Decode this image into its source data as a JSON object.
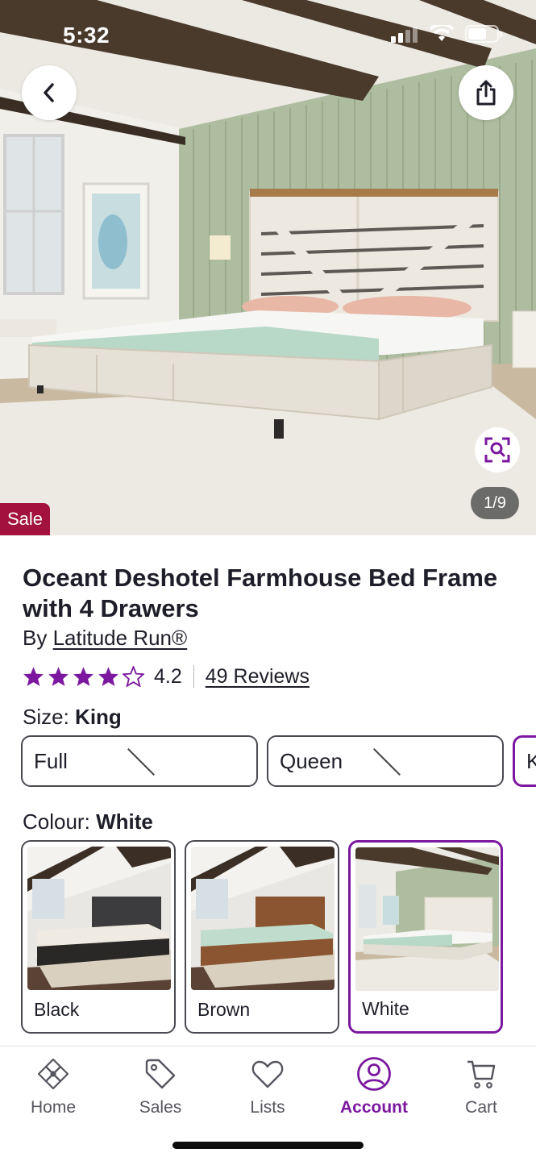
{
  "status_bar": {
    "time": "5:32"
  },
  "hero": {
    "image_counter": "1/9",
    "sale_badge": "Sale",
    "icons": {
      "back": "chevron-left-icon",
      "share": "share-icon",
      "visual_search": "visual-search-icon"
    }
  },
  "product": {
    "title": "Oceant Deshotel Farmhouse Bed Frame with 4 Drawers",
    "by_prefix": "By",
    "brand": "Latitude Run®",
    "rating_value": "4.2",
    "rating_stars": 4.2,
    "reviews": "49 Reviews"
  },
  "size": {
    "label": "Size:",
    "selected": "King",
    "options": [
      {
        "label": "Full",
        "unavailable": true
      },
      {
        "label": "Queen",
        "unavailable": true
      },
      {
        "label": "K",
        "unavailable": false
      }
    ]
  },
  "colour": {
    "label": "Colour:",
    "selected": "White",
    "options": [
      {
        "label": "Black"
      },
      {
        "label": "Brown"
      },
      {
        "label": "White"
      }
    ]
  },
  "bottom_nav": {
    "items": [
      {
        "label": "Home",
        "icon": "home-icon"
      },
      {
        "label": "Sales",
        "icon": "tag-icon"
      },
      {
        "label": "Lists",
        "icon": "heart-icon"
      },
      {
        "label": "Account",
        "icon": "account-icon",
        "active": true
      },
      {
        "label": "Cart",
        "icon": "cart-icon"
      }
    ]
  },
  "colors": {
    "accent": "#7b189f",
    "sale": "#a3123e",
    "star": "#7b189f"
  }
}
